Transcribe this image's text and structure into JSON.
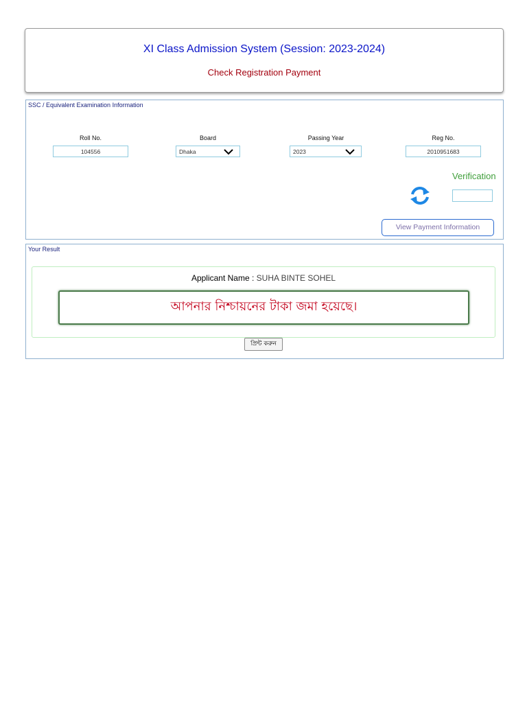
{
  "header": {
    "title": "XI Class Admission System (Session: 2023-2024)",
    "subtitle": "Check Registration Payment"
  },
  "exam_info": {
    "legend": "SSC / Equivalent Examination Information",
    "roll": {
      "label": "Roll No.",
      "value": "104556"
    },
    "board": {
      "label": "Board",
      "value": "Dhaka"
    },
    "year": {
      "label": "Passing Year",
      "value": "2023"
    },
    "reg": {
      "label": "Reg No.",
      "value": "2010951683"
    },
    "verification": {
      "label": "Verification",
      "value": ""
    },
    "view_button": "View Payment Information"
  },
  "result": {
    "legend": "Your Result",
    "applicant_label": "Applicant Name",
    "applicant_sep": " : ",
    "applicant_value": "SUHA BINTE SOHEL",
    "message": "আপনার নিশ্চায়নের টাকা জমা হয়েছে।",
    "print_button": "প্রিন্ট করুন"
  },
  "icons": {
    "refresh": "refresh-icon",
    "dropdown": "chevron-down-icon"
  },
  "colors": {
    "title": "#0a14c8",
    "subtitle": "#a3000e",
    "verification": "#3f9e3a",
    "message": "#c2001a",
    "refresh": "#1e88e5"
  }
}
